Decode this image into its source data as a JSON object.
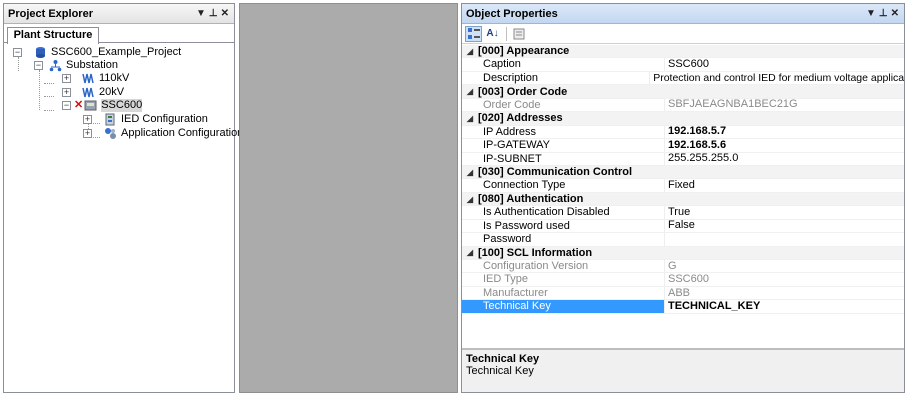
{
  "project_explorer": {
    "title": "Project Explorer",
    "controls": [
      "▼",
      "⊥",
      "✕"
    ],
    "tab_label": "Plant Structure",
    "tree": {
      "root": "SSC600_Example_Project",
      "substation": "Substation",
      "voltage_levels": [
        "110kV",
        "20kV"
      ],
      "ied": "SSC600",
      "ied_children": [
        "IED Configuration",
        "Application Configuration"
      ]
    }
  },
  "object_properties": {
    "title": "Object Properties",
    "controls": [
      "▼",
      "⊥",
      "✕"
    ],
    "toolbar": {
      "categorized_icon": "categorized-icon",
      "alphabetical_label": "A↓",
      "pages_icon": "property-pages-icon"
    },
    "categories": [
      {
        "name": "[000] Appearance",
        "props": [
          {
            "key": "Caption",
            "value": "SSC600"
          },
          {
            "key": "Description",
            "value": "Protection and control IED for medium voltage applications"
          }
        ]
      },
      {
        "name": "[003] Order Code",
        "props": [
          {
            "key": "Order Code",
            "value": "SBFJAEAGNBA1BEC21G"
          }
        ]
      },
      {
        "name": "[020] Addresses",
        "props": [
          {
            "key": "IP Address",
            "value": "192.168.5.7"
          },
          {
            "key": "IP-GATEWAY",
            "value": "192.168.5.6"
          },
          {
            "key": "IP-SUBNET",
            "value": "255.255.255.0"
          }
        ]
      },
      {
        "name": "[030] Communication Control",
        "props": [
          {
            "key": "Connection Type",
            "value": "Fixed"
          }
        ]
      },
      {
        "name": "[080] Authentication",
        "props": [
          {
            "key": "Is Authentication Disabled",
            "value": "True"
          },
          {
            "key": "Is Password used",
            "value": "False"
          },
          {
            "key": "Password",
            "value": ""
          }
        ]
      },
      {
        "name": "[100] SCL Information",
        "props": [
          {
            "key": "Configuration Version",
            "value": "G"
          },
          {
            "key": "IED Type",
            "value": "SSC600"
          },
          {
            "key": "Manufacturer",
            "value": "ABB"
          },
          {
            "key": "Technical Key",
            "value": "TECHNICAL_KEY"
          }
        ]
      }
    ],
    "description_panel": {
      "title": "Technical Key",
      "text": "Technical Key"
    }
  },
  "colors": {
    "selection": "#3399ff",
    "workspace_gray": "#ababab",
    "op_header": "#c3d7f1"
  }
}
